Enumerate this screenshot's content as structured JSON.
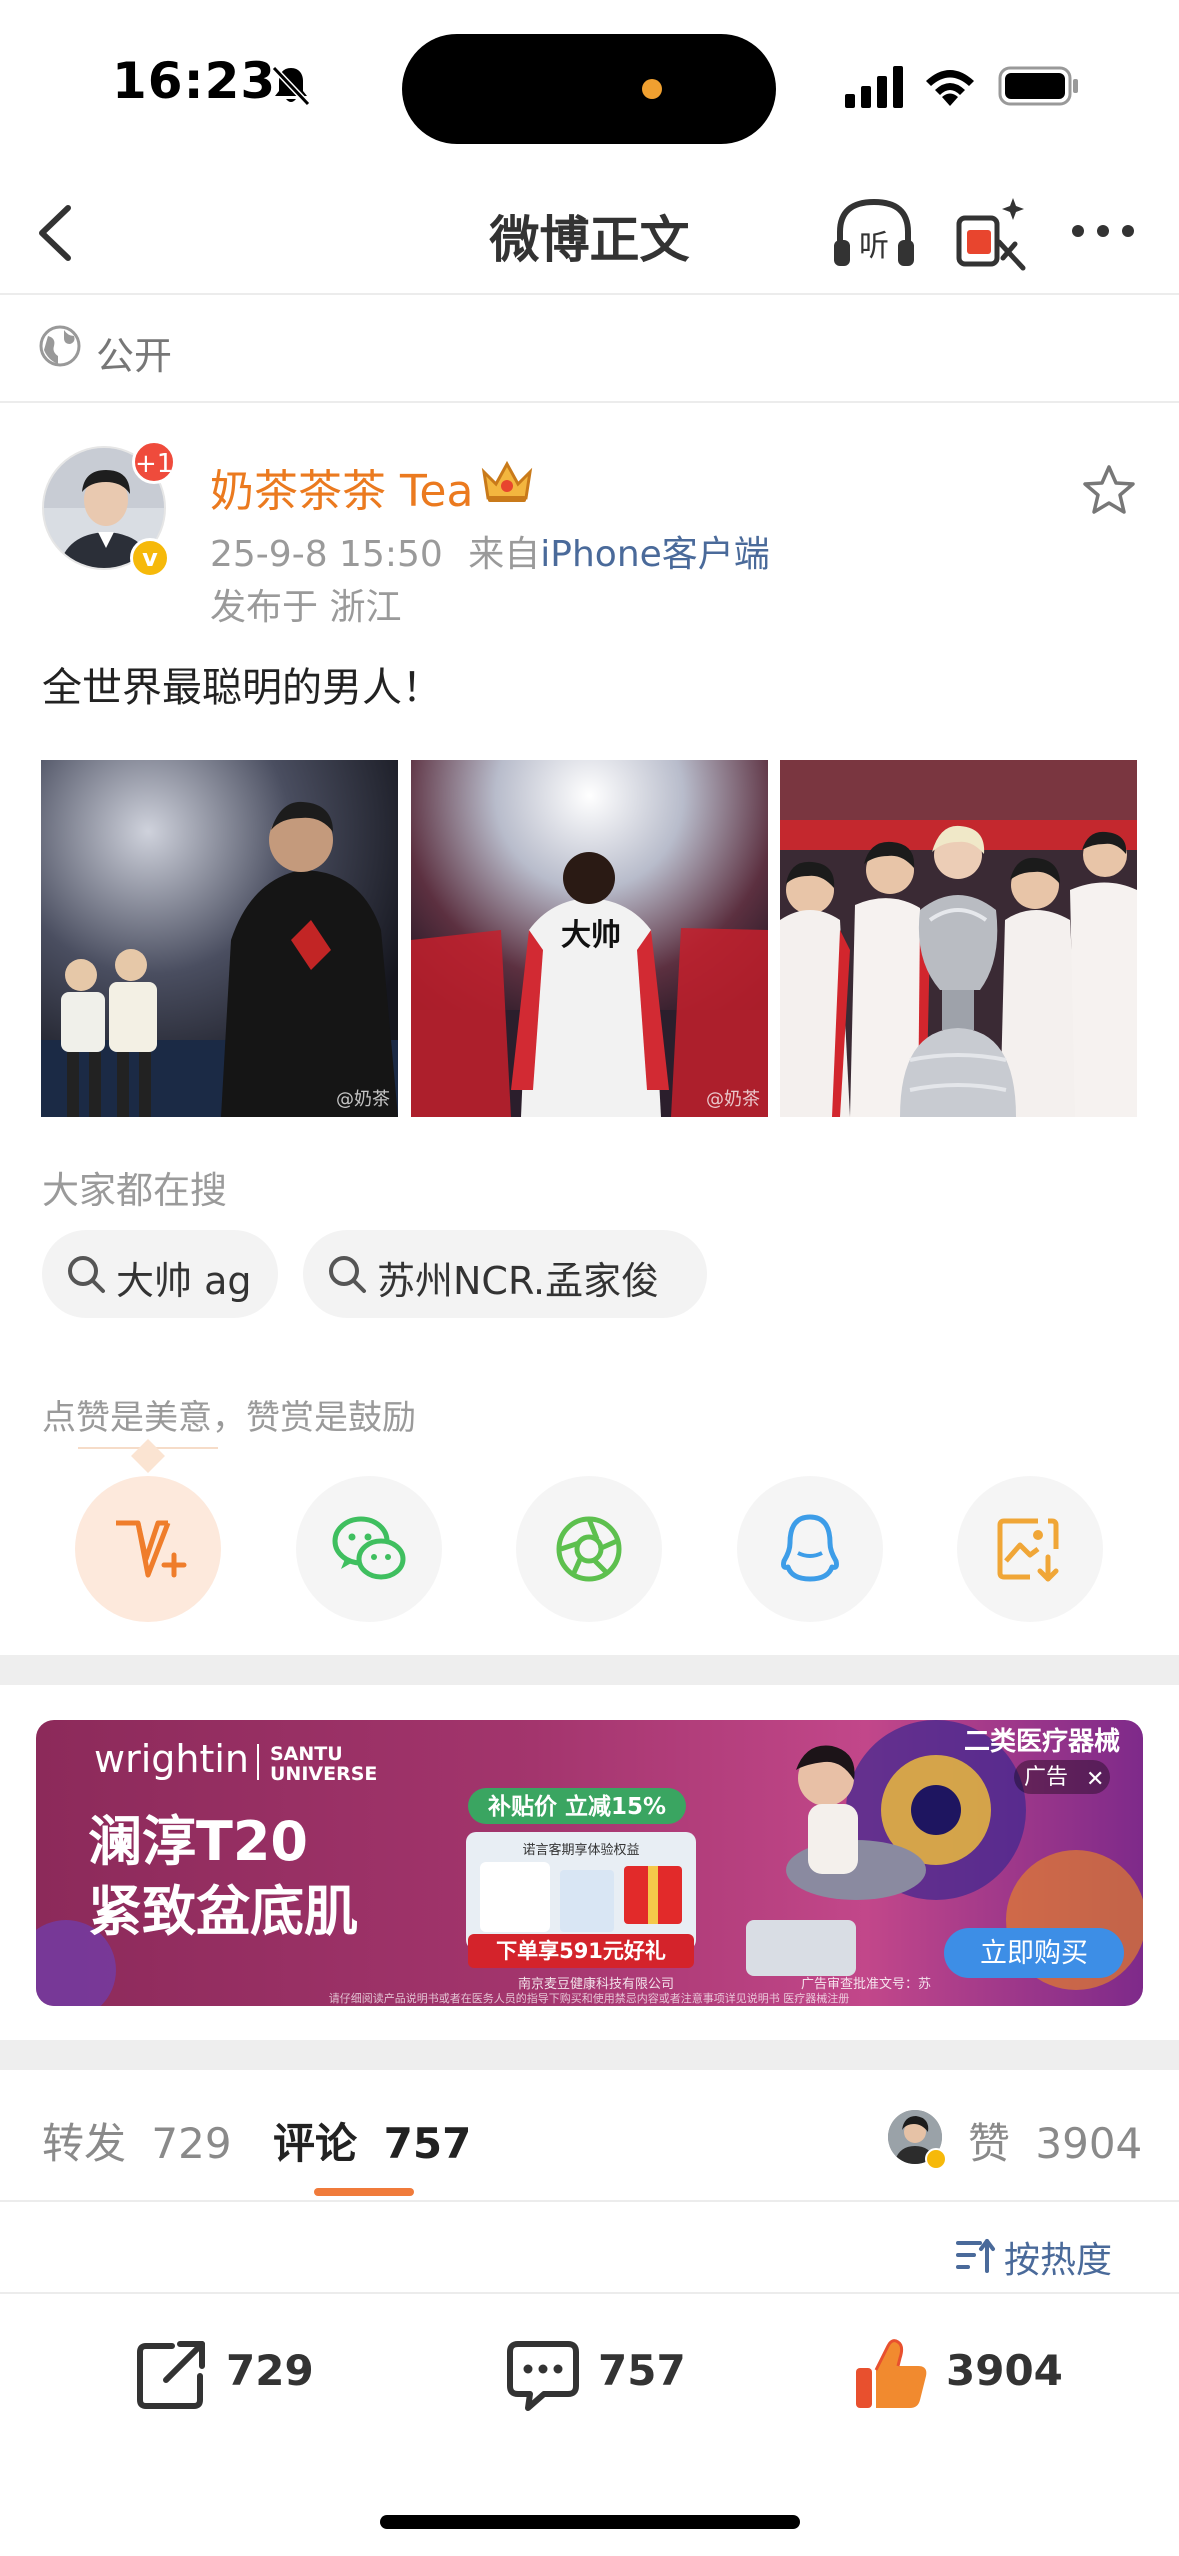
{
  "status_bar": {
    "time": "16:23",
    "icons": [
      "bell-slash-icon",
      "signal-icon",
      "wifi-icon",
      "battery-icon"
    ]
  },
  "nav": {
    "title": "微博正文",
    "icons": [
      "back-icon",
      "listen-icon",
      "red-packet-icon",
      "more-icon"
    ],
    "listen_glyph": "听"
  },
  "visibility": {
    "label": "公开"
  },
  "post": {
    "username": "奶茶茶茶 Tea",
    "avatar_badge": "+1",
    "verified_mark": "v",
    "time": "25-9-8 15:50",
    "from_prefix": "来自",
    "source": "iPhone客户端",
    "location": "发布于 浙江",
    "text": "全世界最聪明的男人！",
    "images": [
      {
        "watermark": "@奶茶"
      },
      {
        "watermark": "@奶茶",
        "jersey_text": "大帅"
      },
      {
        "watermark": ""
      }
    ]
  },
  "searches": {
    "title": "大家都在搜",
    "items": [
      "大帅 ag",
      "苏州NCR.孟家俊"
    ]
  },
  "reward": {
    "text": "点赞是美意，赞赏是鼓励"
  },
  "share_buttons": [
    "reward-icon",
    "wechat-icon",
    "moments-icon",
    "qq-icon",
    "save-image-icon"
  ],
  "ad": {
    "brand": "wrightin",
    "brand2_line1": "SANTU",
    "brand2_line2": "UNIVERSE",
    "category_tag": "二类医疗器械",
    "ad_label": "广告",
    "headline_line1": "澜淳T20",
    "headline_line2": "紧致盆底肌",
    "promo": "补贴价 立减15%",
    "gift": "下单享591元好礼",
    "box_label": "诺言客期享体验权益",
    "cta": "立即购买",
    "company": "南京麦豆健康科技有限公司",
    "approval": "广告审查批准文号：苏",
    "disclaimer": "请仔细阅读产品说明书或者在医务人员的指导下购买和使用禁忌内容或者注意事项详见说明书 医疗器械注册"
  },
  "tabs": {
    "repost_label": "转发",
    "repost_count": "729",
    "comment_label": "评论",
    "comment_count": "757",
    "like_label": "赞",
    "like_count": "3904"
  },
  "sort": {
    "label": "按热度"
  },
  "bottom_bar": {
    "repost": "729",
    "comment": "757",
    "like": "3904"
  },
  "colors": {
    "accent_orange": "#eb7a1f",
    "link_blue": "#4a6a9a",
    "tab_underline": "#f07b3b"
  }
}
